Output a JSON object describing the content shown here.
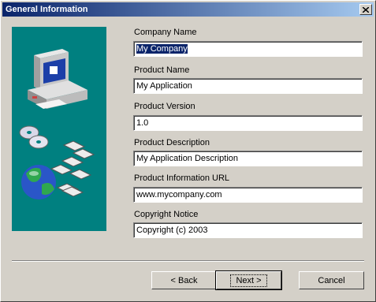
{
  "window": {
    "title": "General Information",
    "close_glyph": "✕"
  },
  "form": {
    "company_name": {
      "label": "Company Name",
      "value": "My Company"
    },
    "product_name": {
      "label": "Product Name",
      "value": "My Application"
    },
    "product_version": {
      "label": "Product Version",
      "value": "1.0"
    },
    "product_description": {
      "label": "Product Description",
      "value": "My Application Description"
    },
    "product_url": {
      "label": "Product Information URL",
      "value": "www.mycompany.com"
    },
    "copyright": {
      "label": "Copyright Notice",
      "value": "Copyright (c) 2003"
    }
  },
  "buttons": {
    "back": "< Back",
    "next": "Next >",
    "cancel": "Cancel"
  },
  "colors": {
    "title_start": "#0a246a",
    "title_end": "#a6caf0",
    "art_bg": "#008080",
    "selection": "#0a246a"
  },
  "icons": [
    "computer-icon",
    "cd-discs-icon",
    "globe-icon",
    "floppy-disks-icon",
    "close-icon"
  ]
}
